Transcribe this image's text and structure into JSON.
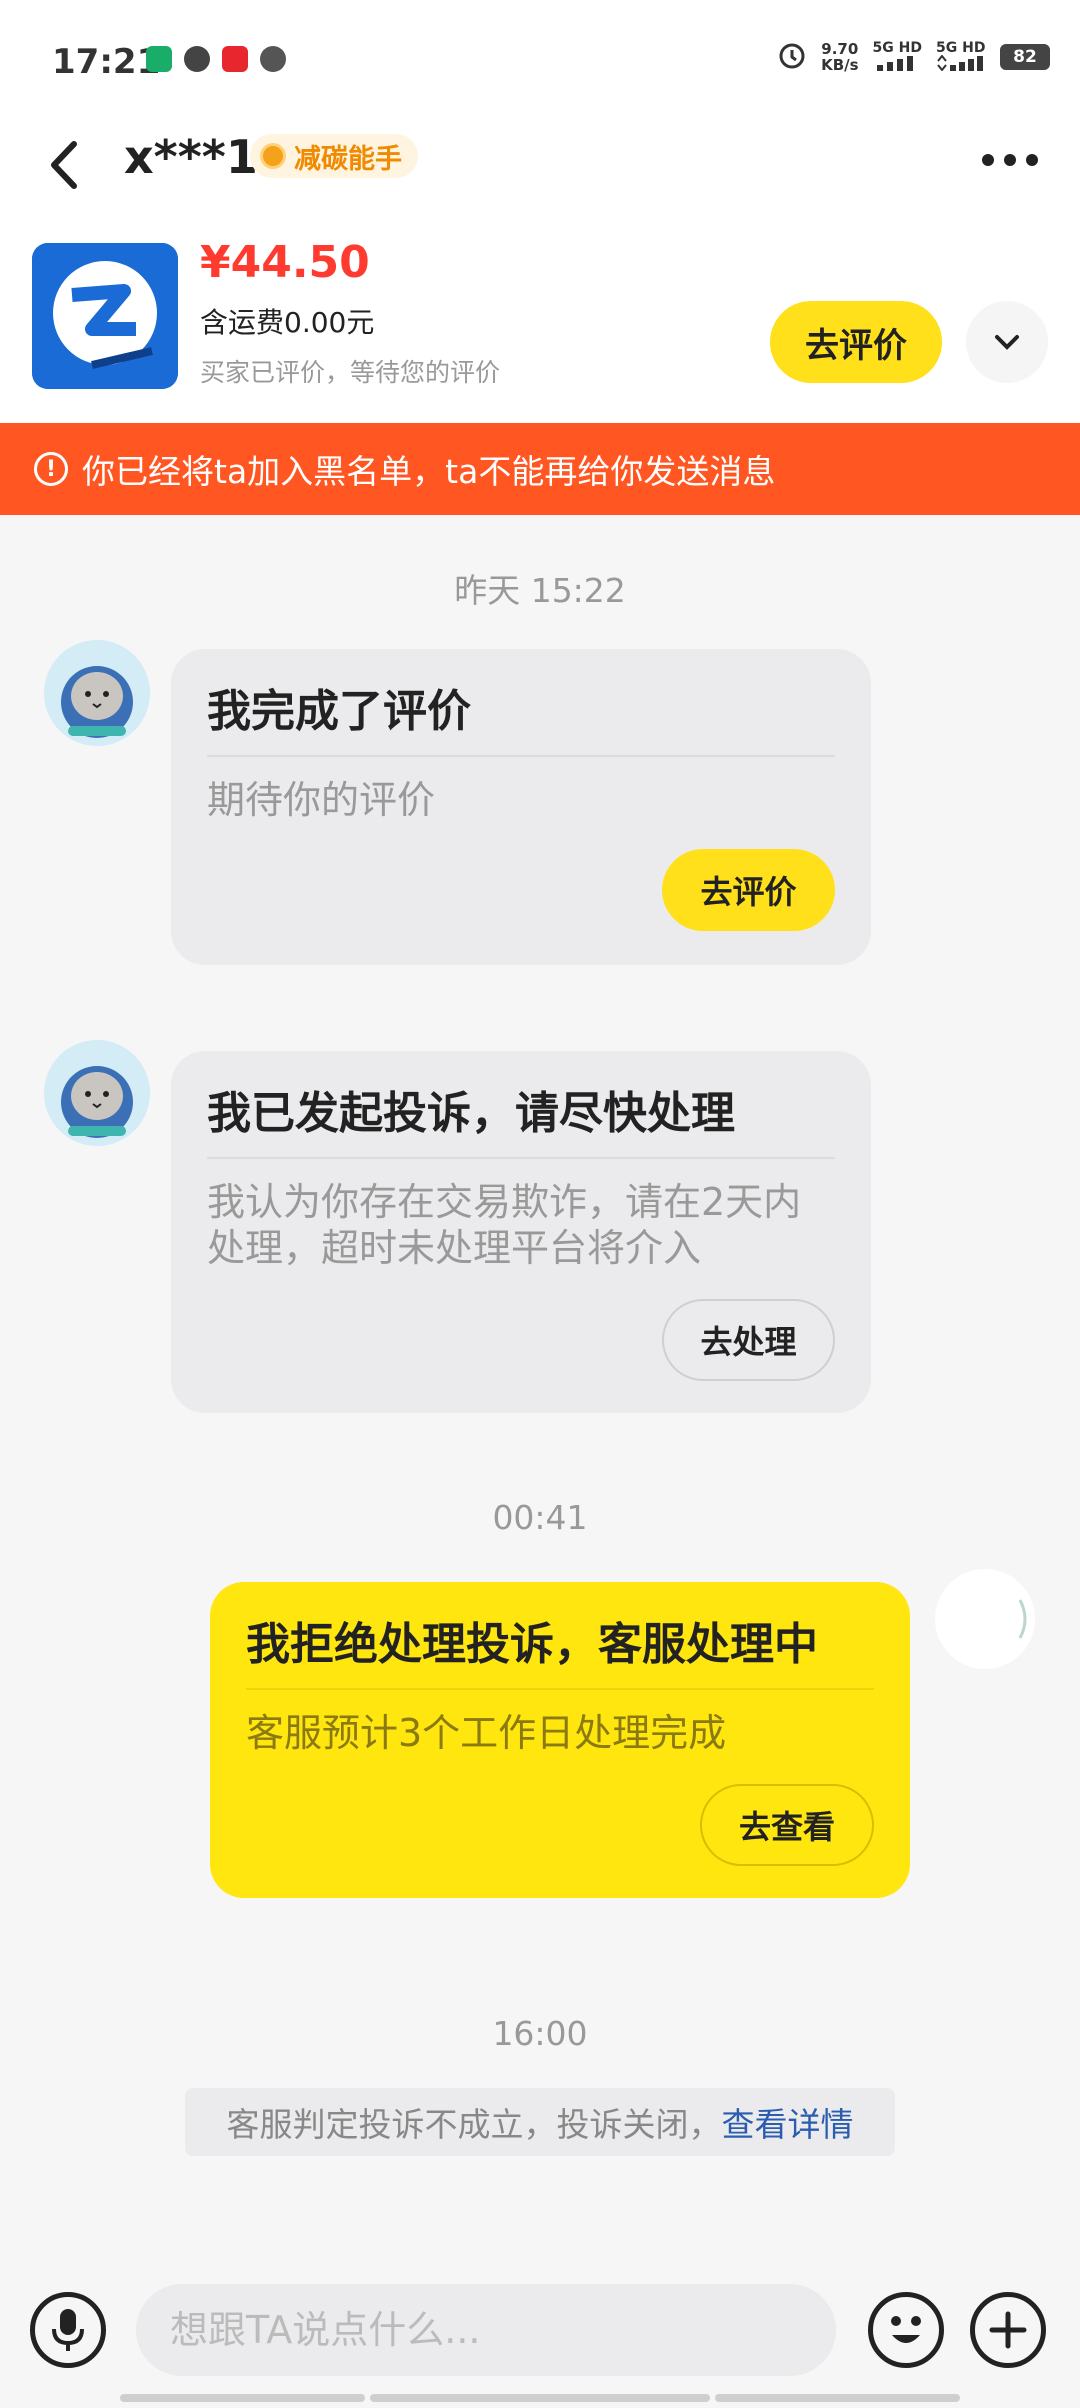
{
  "status_bar": {
    "time": "17:21",
    "speed_value": "9.70",
    "speed_unit": "KB/s",
    "signal1": "5G HD",
    "signal2": "5G HD",
    "battery": "82",
    "notification_icons": [
      "qr-wallet-icon",
      "chat-bubble-icon",
      "red-app-icon",
      "wechat-icon"
    ]
  },
  "header": {
    "contact_name": "x***1",
    "badge": "减碳能手"
  },
  "product": {
    "price": "¥44.50",
    "shipping": "含运费0.00元",
    "status": "买家已评价，等待您的评价",
    "rate_button": "去评价"
  },
  "banner": {
    "text": "你已经将ta加入黑名单，ta不能再给你发送消息"
  },
  "messages": [
    {
      "timestamp": "昨天 15:22",
      "title": "我完成了评价",
      "body": "期待你的评价",
      "button": "去评价"
    },
    {
      "title": "我已发起投诉，请尽快处理",
      "body": "我认为你存在交易欺诈，请在2天内处理，超时未处理平台将介入",
      "button": "去处理"
    },
    {
      "timestamp": "00:41",
      "title": "我拒绝处理投诉，客服处理中",
      "body": "客服预计3个工作日处理完成",
      "button": "去查看"
    }
  ],
  "system": {
    "timestamp": "16:00",
    "note": "客服判定投诉不成立，投诉关闭，",
    "link": "查看详情"
  },
  "input": {
    "placeholder": "想跟TA说点什么..."
  },
  "colors": {
    "accent_yellow": "#ffe01a",
    "banner_orange": "#ff5622",
    "price_red": "#ff3b30",
    "link_blue": "#2a5db0"
  }
}
